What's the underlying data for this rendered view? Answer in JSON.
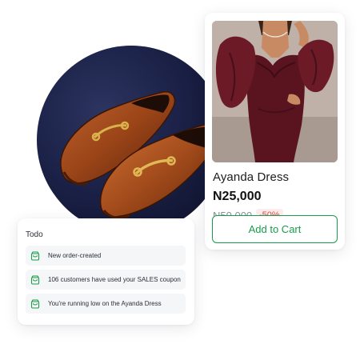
{
  "product": {
    "name": "Ayanda Dress",
    "price": "N25,000",
    "old_price": "N50,000",
    "discount": "-50%",
    "add_to_cart_label": "Add to Cart",
    "image_icon": "dress-photo"
  },
  "shoe_image": {
    "icon": "loafers-photo"
  },
  "todo": {
    "title": "Todo",
    "items": [
      {
        "text": "New order-created",
        "icon": "shopping-bag-icon"
      },
      {
        "text": "106 customers have used your SALES coupon",
        "icon": "shopping-bag-icon"
      },
      {
        "text": "You're running low on the Ayanda Dress",
        "icon": "shopping-bag-icon"
      }
    ]
  },
  "colors": {
    "accent_green": "#1a9b4b",
    "discount_red": "#e0444a",
    "discount_bg": "#fdecec",
    "dress_burgundy": "#5a1420",
    "backdrop_navy": "#1b2147"
  }
}
